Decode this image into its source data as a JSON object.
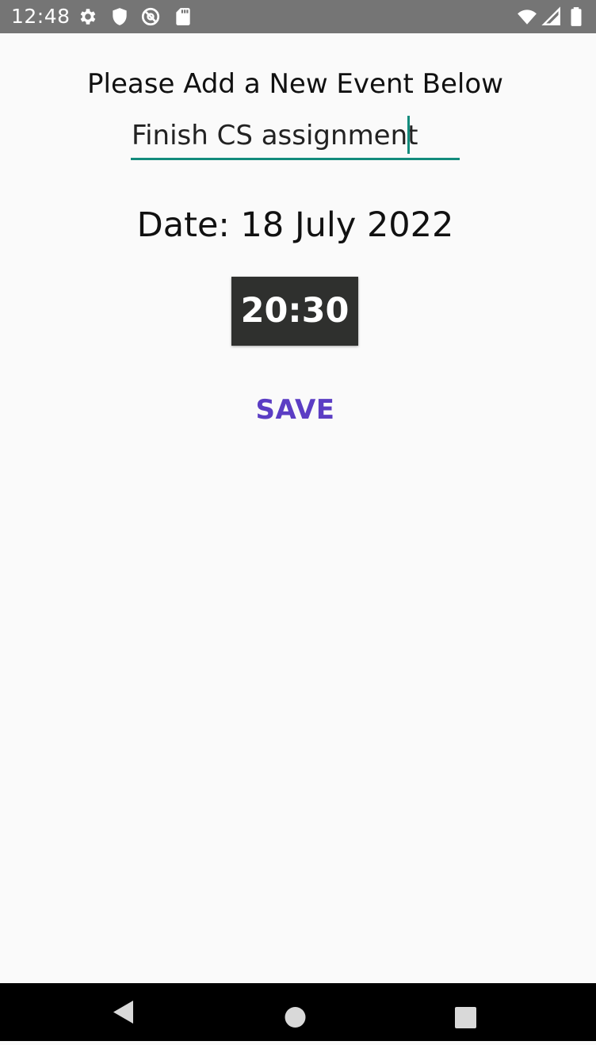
{
  "status_bar": {
    "time": "12:48",
    "left_icons": [
      "gear-icon",
      "shield-icon",
      "no-entry-at-icon",
      "sd-card-icon"
    ],
    "right_icons": [
      "wifi-icon",
      "signal-icon",
      "battery-icon"
    ]
  },
  "form": {
    "heading": "Please Add a New Event Below",
    "event_input_value": "Finish CS assignment",
    "date_label": "Date: 18 July 2022",
    "time_button_label": "20:30",
    "save_label": "SAVE"
  },
  "colors": {
    "accent": "#138b7c",
    "save_text": "#5b3dc4",
    "time_button_bg": "#2f302e",
    "status_bar_bg": "#757575"
  },
  "nav_bar": {
    "buttons": [
      "back-icon",
      "home-icon",
      "recents-icon"
    ]
  }
}
